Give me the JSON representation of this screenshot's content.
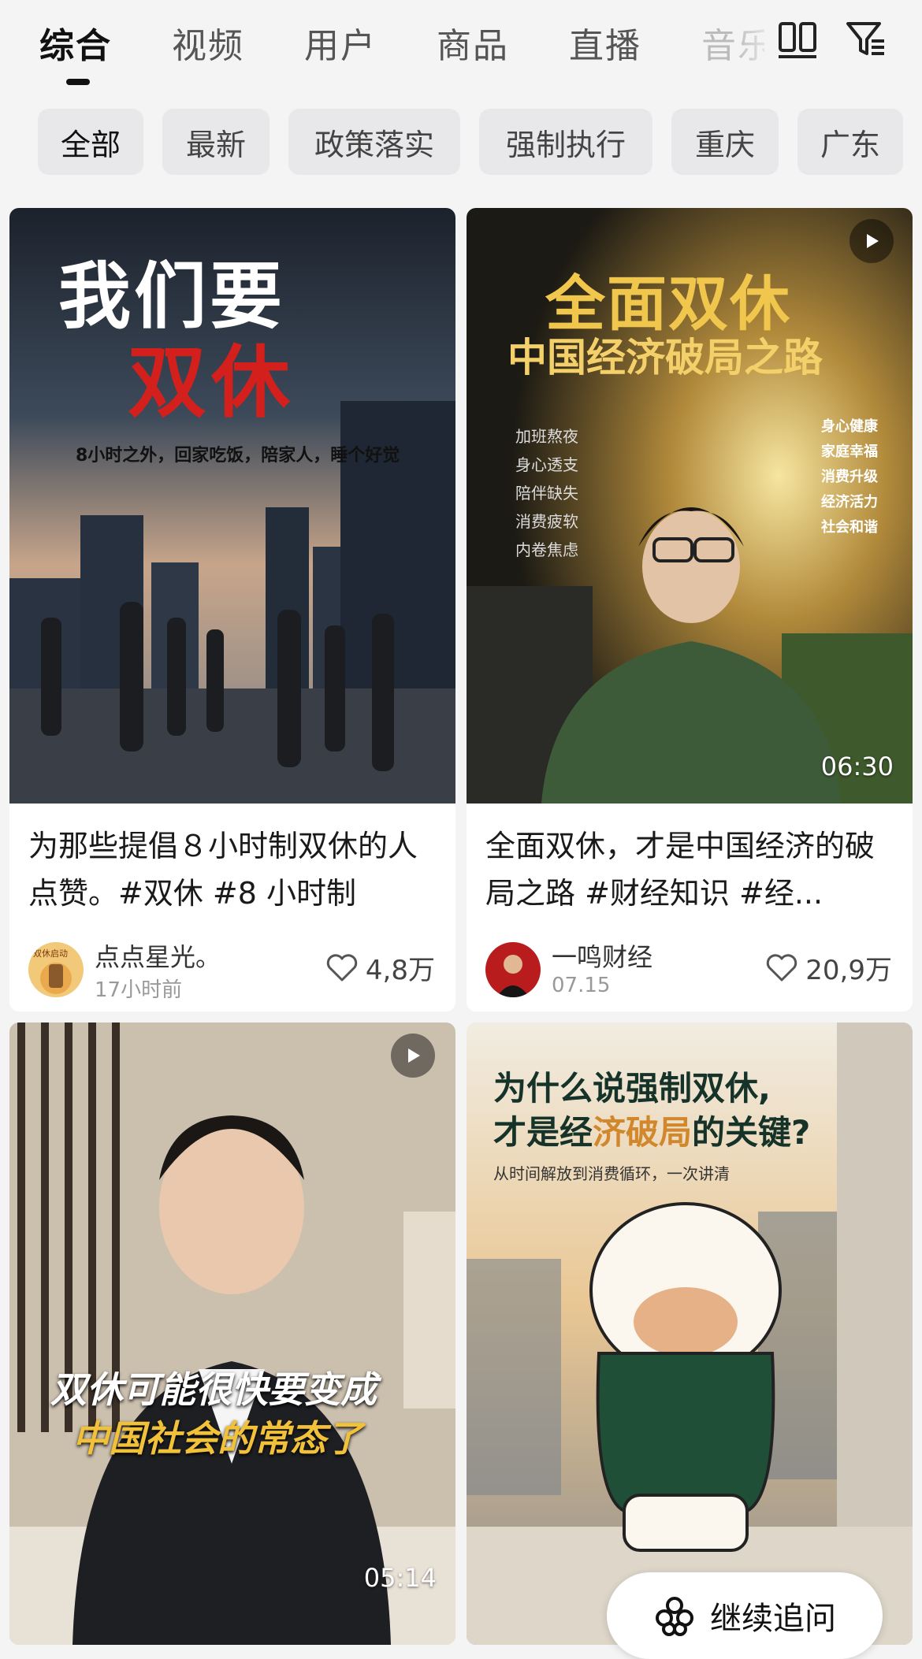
{
  "tabs": [
    {
      "label": "综合",
      "active": true
    },
    {
      "label": "视频"
    },
    {
      "label": "用户"
    },
    {
      "label": "商品"
    },
    {
      "label": "直播"
    },
    {
      "label": "音乐"
    }
  ],
  "top_icons": [
    "dual-column-icon",
    "filter-icon"
  ],
  "chips": [
    {
      "label": "全部",
      "active": true
    },
    {
      "label": "最新"
    },
    {
      "label": "政策落实"
    },
    {
      "label": "强制执行"
    },
    {
      "label": "重庆"
    },
    {
      "label": "广东"
    }
  ],
  "cards": [
    {
      "cover_text": {
        "line1": "我们要",
        "line2": "双休",
        "sub": "8小时之外，回家吃饭，陪家人，睡个好觉"
      },
      "title": "为那些提倡８小时制双休的人点赞。#双休 #8 小时制",
      "author": "点点星光。",
      "avatar_text": "双休启动",
      "time": "17小时前",
      "likes": "4,8万"
    },
    {
      "cover_text": {
        "line1": "全面双休",
        "line2": "中国经济破局之路",
        "left_list": [
          "加班熬夜",
          "身心透支",
          "陪伴缺失",
          "消费疲软",
          "内卷焦虑"
        ],
        "right_list": [
          "身心健康",
          "家庭幸福",
          "消费升级",
          "经济活力",
          "社会和谐"
        ]
      },
      "duration": "06:30",
      "title": "全面双休，才是中国经济的破局之路 #财经知识 #经...",
      "author": "一鸣财经",
      "time": "07.15",
      "likes": "20,9万"
    },
    {
      "cover_text": {
        "line1": "双休可能很快要变成",
        "line2": "中国社会的常态了"
      },
      "duration": "05:14"
    },
    {
      "cover_text": {
        "line1": "为什么说强制双休,",
        "line2a": "才是经",
        "line2b": "济破局",
        "line2c": "的关键?",
        "sub": "从时间解放到消费循环，一次讲清"
      }
    }
  ],
  "continue_button": "继续追问"
}
